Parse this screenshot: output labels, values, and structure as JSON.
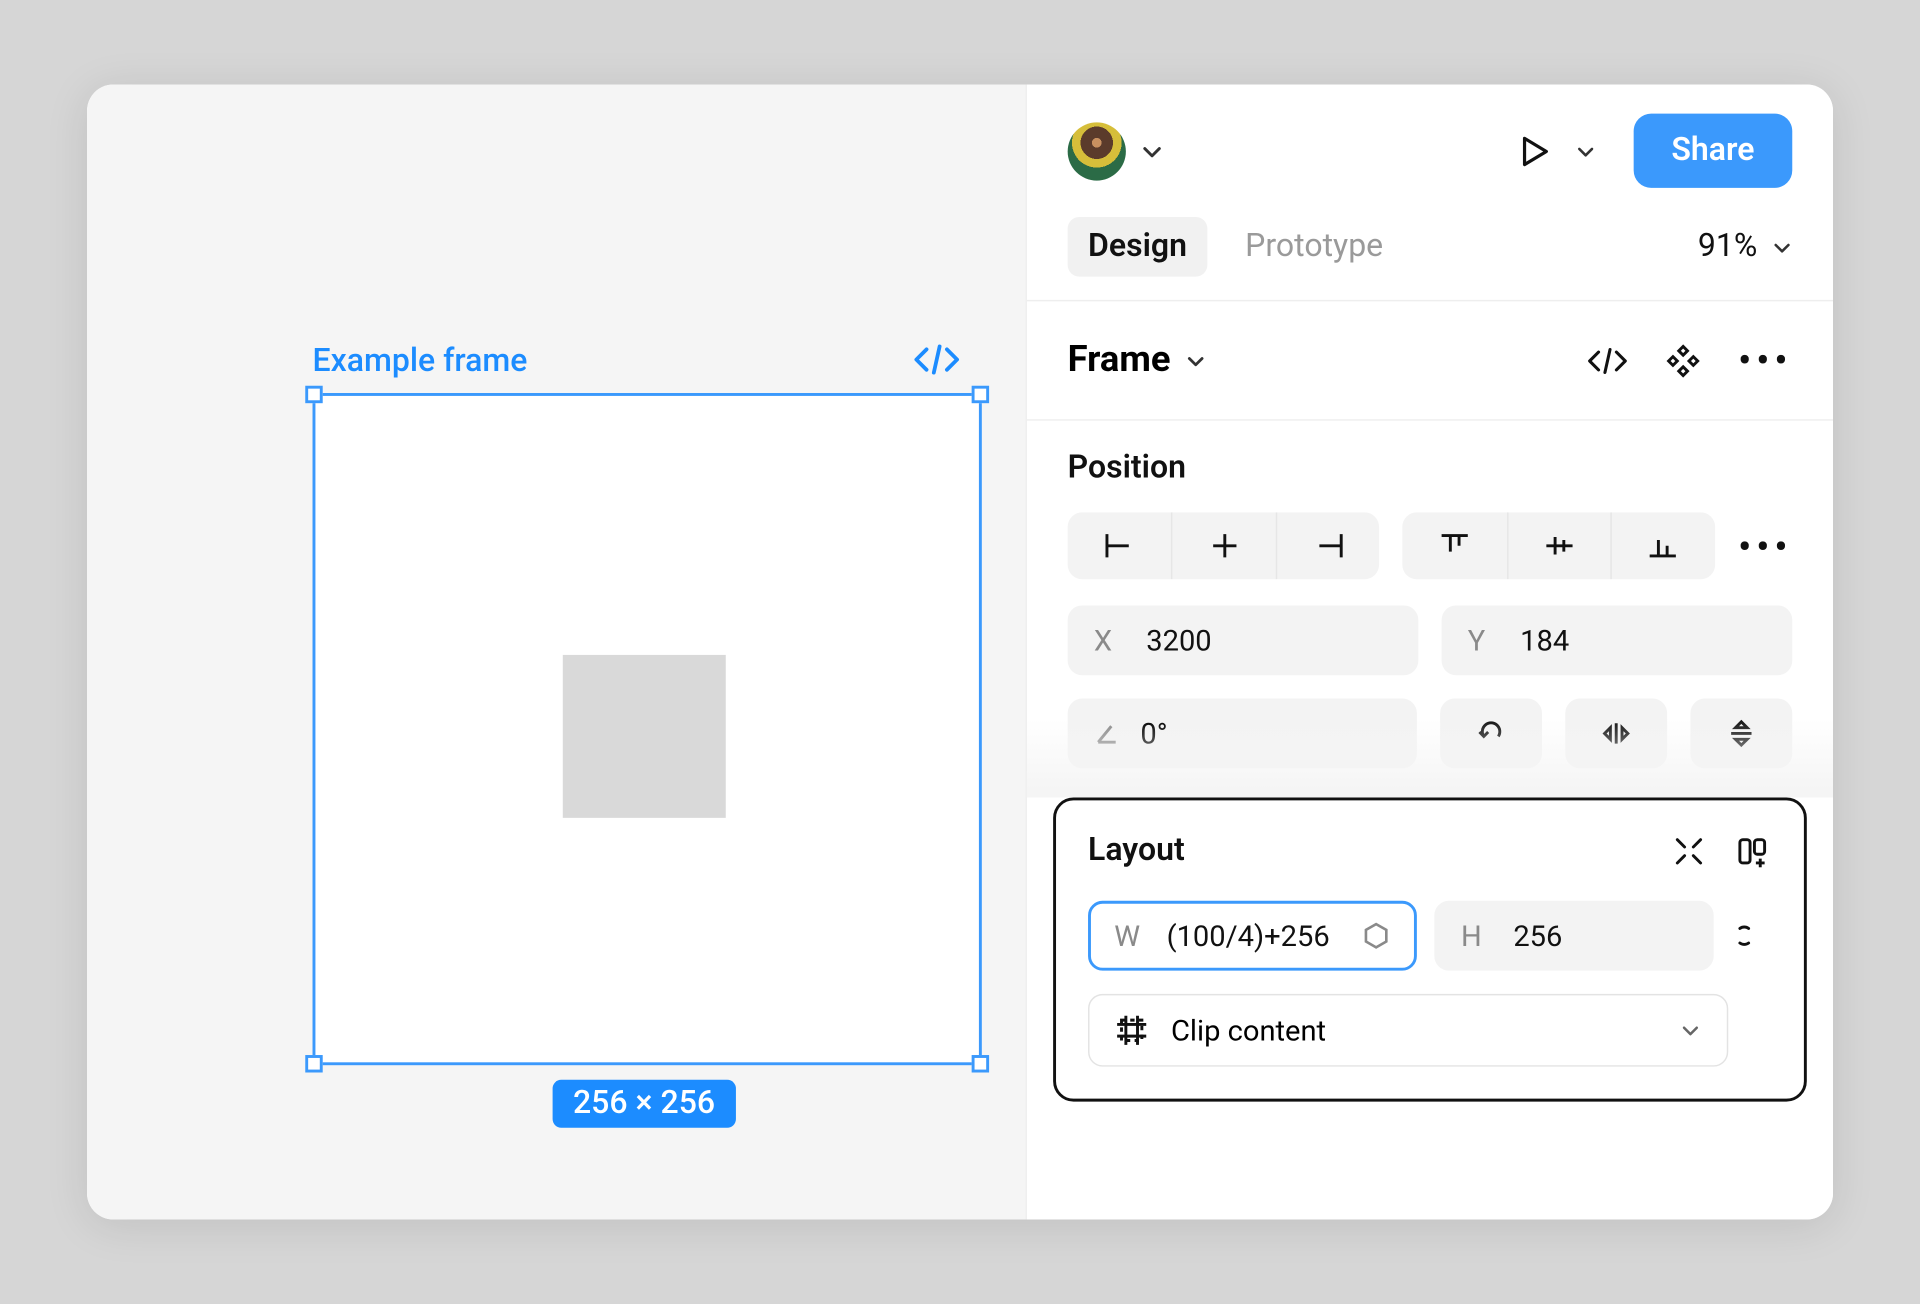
{
  "canvas": {
    "frame_label": "Example frame",
    "dimensions_badge": "256 × 256"
  },
  "topbar": {
    "share_label": "Share"
  },
  "tabs": {
    "design": "Design",
    "prototype": "Prototype",
    "zoom": "91%"
  },
  "frame_section": {
    "title": "Frame"
  },
  "position": {
    "title": "Position",
    "x_label": "X",
    "x_value": "3200",
    "y_label": "Y",
    "y_value": "184",
    "rotation_value": "0°"
  },
  "layout": {
    "title": "Layout",
    "w_label": "W",
    "w_value": "(100/4)+256",
    "h_label": "H",
    "h_value": "256",
    "clip_label": "Clip content"
  }
}
